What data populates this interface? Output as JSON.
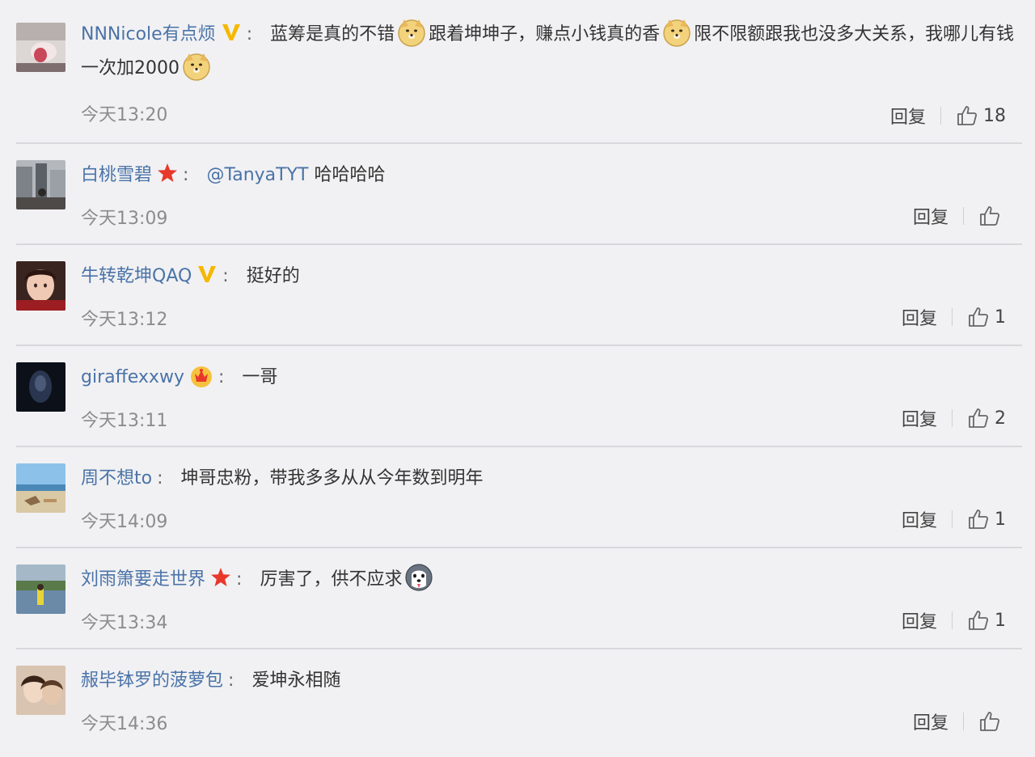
{
  "comments": [
    {
      "username": "NNNicole有点烦",
      "badge": "vip-v-icon",
      "text_parts": [
        "蓝筹是真的不错",
        "跟着坤坤子，赚点小钱真的香",
        "限不限额跟我也没多大关系，我哪儿有钱一次加2000"
      ],
      "time": "今天13:20",
      "reply_label": "回复",
      "likes": "18"
    },
    {
      "username": "白桃雪碧",
      "badge": "star-icon",
      "mention": "@TanyaTYT",
      "text": "哈哈哈哈",
      "time": "今天13:09",
      "reply_label": "回复",
      "likes": ""
    },
    {
      "username": "牛转乾坤QAQ",
      "badge": "vip-v-icon",
      "text": "挺好的",
      "time": "今天13:12",
      "reply_label": "回复",
      "likes": "1"
    },
    {
      "username": "giraffexxwy",
      "badge": "crown-icon",
      "text": "一哥",
      "time": "今天13:11",
      "reply_label": "回复",
      "likes": "2"
    },
    {
      "username": "周不想to",
      "badge": "",
      "text": "坤哥忠粉，带我多多从从今年数到明年",
      "time": "今天14:09",
      "reply_label": "回复",
      "likes": "1"
    },
    {
      "username": "刘雨箫要走世界",
      "badge": "star-icon",
      "text": "厉害了，供不应求",
      "time": "今天13:34",
      "reply_label": "回复",
      "likes": "1"
    },
    {
      "username": "赧毕钵罗的菠萝包",
      "badge": "",
      "text": "爱坤永相随",
      "time": "今天14:36",
      "reply_label": "回复",
      "likes": ""
    }
  ],
  "colors": {
    "username": "#4a73a8",
    "background": "#f1f1f3",
    "vip": "#f5b800",
    "star": "#e8382c"
  }
}
